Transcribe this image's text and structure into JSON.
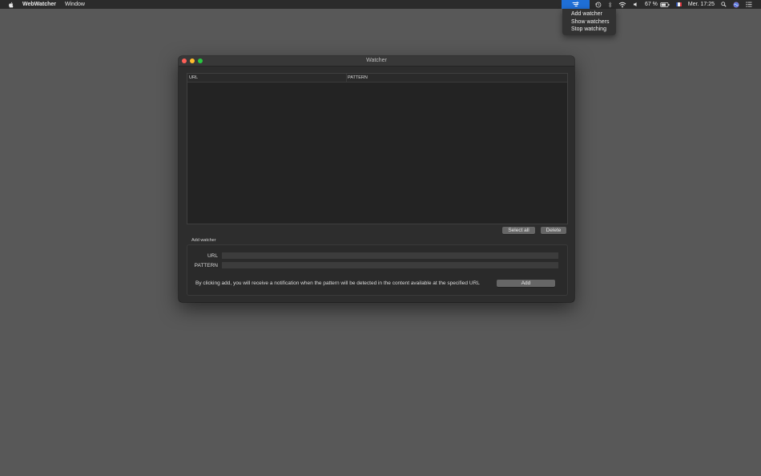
{
  "menubar": {
    "app_name": "WebWatcher",
    "menus": [
      "Window"
    ],
    "battery": "67 %",
    "clock": "Mer. 17:25",
    "icons": [
      "apple-icon",
      "webwatcher-status-icon",
      "time-machine-icon",
      "bluetooth-icon",
      "wifi-icon",
      "volume-icon",
      "battery-icon",
      "french-flag-icon",
      "spotlight-icon",
      "siri-icon",
      "notification-center-icon"
    ],
    "accent": "#1f6fd6"
  },
  "status_menu": {
    "items": [
      "Add watcher",
      "Show watchers",
      "Stop watching"
    ]
  },
  "window": {
    "title": "Watcher",
    "table": {
      "columns": [
        "URL",
        "PATTERN"
      ],
      "rows": []
    },
    "select_all_label": "Select all",
    "delete_label": "Delete",
    "add_group": {
      "title": "Add watcher",
      "url_label": "URL",
      "url_value": "",
      "pattern_label": "PATTERN",
      "pattern_value": "",
      "note": "By clicking add, you will receive a notification when the pattern will be detected in the content available at the specified URL",
      "add_label": "Add"
    }
  }
}
